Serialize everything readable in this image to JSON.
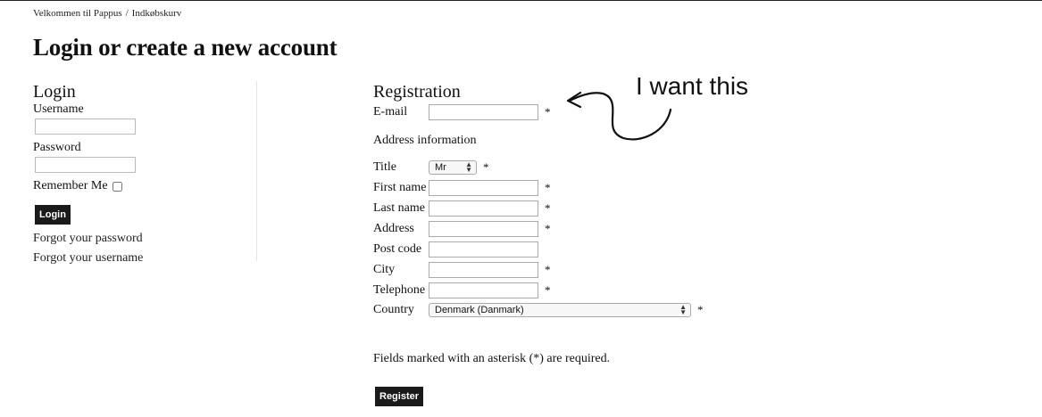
{
  "breadcrumb": {
    "home": "Velkommen til Pappus",
    "separator": "/",
    "current": "Indkøbskurv"
  },
  "page_title": "Login or create a new account",
  "login": {
    "heading": "Login",
    "username_label": "Username",
    "username_value": "",
    "password_label": "Password",
    "password_value": "",
    "remember_label": "Remember Me",
    "remember_checked": false,
    "button_label": "Login",
    "forgot_password": "Forgot your password",
    "forgot_username": "Forgot your username"
  },
  "registration": {
    "heading": "Registration",
    "email_label": "E-mail",
    "address_info": "Address information",
    "title_label": "Title",
    "title_value": "Mr",
    "first_name_label": "First name",
    "last_name_label": "Last name",
    "address_label": "Address",
    "post_code_label": "Post code",
    "city_label": "City",
    "telephone_label": "Telephone",
    "country_label": "Country",
    "country_value": "Denmark (Danmark)",
    "asterisk": "*",
    "required_note": "Fields marked with an asterisk (*) are required.",
    "button_label": "Register"
  },
  "annotation": {
    "text": "I want this"
  }
}
